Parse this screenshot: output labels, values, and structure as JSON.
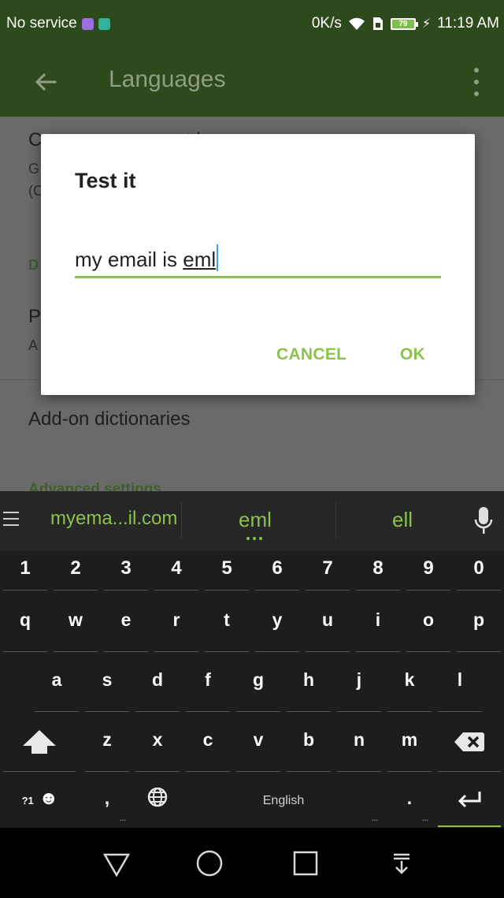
{
  "status_bar": {
    "carrier": "No service",
    "net_speed": "0K/s",
    "battery": "79",
    "time": "11:19 AM"
  },
  "app_bar": {
    "title": "Languages"
  },
  "settings": {
    "item1_title_partial": "C",
    "item1_title_tail": "t l",
    "item1_sub_line1": "G",
    "item1_sub_line2": "(C",
    "category_partial": "D",
    "item2_title_partial": "P",
    "item2_sub_partial": "A",
    "addon_dictionaries": "Add-on dictionaries",
    "advanced_partial": "Advanced settings"
  },
  "dialog": {
    "title": "Test it",
    "input_plain": "my email is ",
    "input_composing": "eml",
    "cancel_label": "CANCEL",
    "ok_label": "OK"
  },
  "keyboard": {
    "suggestions": [
      "myema...il.com",
      "eml",
      "ell"
    ],
    "numbers": [
      "1",
      "2",
      "3",
      "4",
      "5",
      "6",
      "7",
      "8",
      "9",
      "0"
    ],
    "row1": [
      "q",
      "w",
      "e",
      "r",
      "t",
      "y",
      "u",
      "i",
      "o",
      "p"
    ],
    "row2": [
      "a",
      "s",
      "d",
      "f",
      "g",
      "h",
      "j",
      "k",
      "l"
    ],
    "row3": [
      "z",
      "x",
      "c",
      "v",
      "b",
      "n",
      "m"
    ],
    "symbols_label": "?1",
    "comma": ",",
    "space_label": "English",
    "period": "."
  },
  "colors": {
    "accent": "#8bc34a",
    "app_bar": "#2c4a1b",
    "keyboard_bg": "#1d1d1d",
    "scrim_bg": "#6a6a6a"
  }
}
